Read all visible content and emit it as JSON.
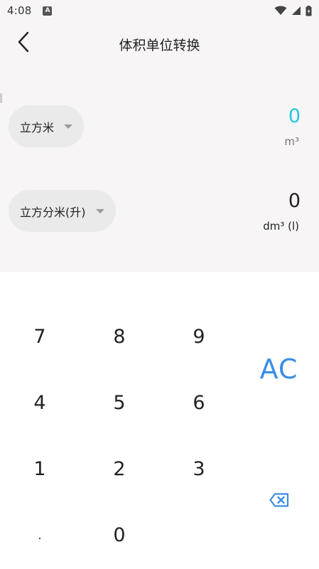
{
  "status_bar": {
    "time": "4:08",
    "notification_icon": "A"
  },
  "header": {
    "title": "体积单位转换",
    "back_icon": "chevron-left"
  },
  "converter": {
    "from": {
      "unit_name": "立方米",
      "value": "0",
      "unit_symbol": "m³",
      "active": true
    },
    "to": {
      "unit_name": "立方分米(升)",
      "value": "0",
      "unit_symbol": "dm³ (l)"
    }
  },
  "keypad": {
    "keys": [
      "7",
      "8",
      "9",
      "4",
      "5",
      "6",
      "1",
      "2",
      "3",
      ".",
      "0"
    ],
    "clear_label": "AC",
    "backspace_icon": "backspace"
  },
  "colors": {
    "active_value": "#22c8e6",
    "accent": "#3a8ee6",
    "panel_bg": "#f7f5f6",
    "pill_bg": "#eaeaea"
  }
}
